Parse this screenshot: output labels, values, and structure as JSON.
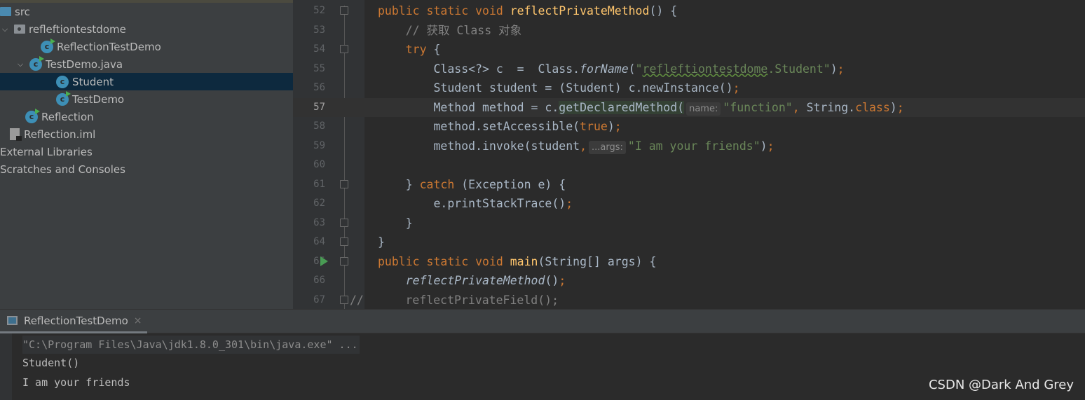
{
  "project_tree": [
    {
      "label": "src",
      "icon": "folder-icon",
      "indent": 0,
      "chevron": false
    },
    {
      "label": "refleftiontestdome",
      "icon": "package-icon",
      "indent": 0,
      "chevron": true
    },
    {
      "label": "ReflectionTestDemo",
      "icon": "class-run-icon",
      "indent": 2,
      "chevron": false
    },
    {
      "label": "TestDemo.java",
      "icon": "class-run-icon",
      "indent": 1,
      "chevron": true
    },
    {
      "label": "Student",
      "icon": "class-icon",
      "indent": 3,
      "chevron": false,
      "selected": true
    },
    {
      "label": "TestDemo",
      "icon": "class-run-icon",
      "indent": 3,
      "chevron": false
    },
    {
      "label": "Reflection",
      "icon": "class-run-icon",
      "indent": 1,
      "chevron": false
    },
    {
      "label": "Reflection.iml",
      "icon": "file-icon",
      "indent": 0,
      "chevron": false
    },
    {
      "label": "External Libraries",
      "icon": "none",
      "indent": -1,
      "chevron": false
    },
    {
      "label": "Scratches and Consoles",
      "icon": "none",
      "indent": -1,
      "chevron": false
    }
  ],
  "editor": {
    "current_line": "57",
    "lines": [
      {
        "n": "52",
        "fold": true,
        "seg": [
          {
            "t": "public static void ",
            "c": "kw"
          },
          {
            "t": "reflectPrivateMethod",
            "c": "fn"
          },
          {
            "t": "() {"
          }
        ]
      },
      {
        "n": "53",
        "seg": [
          {
            "t": "    // 获取 Class 对象",
            "c": "cm"
          }
        ]
      },
      {
        "n": "54",
        "fold": true,
        "seg": [
          {
            "t": "    "
          },
          {
            "t": "try",
            "c": "kw"
          },
          {
            "t": " {"
          }
        ]
      },
      {
        "n": "55",
        "seg": [
          {
            "t": "        Class<?> c  =  Class."
          },
          {
            "t": "forName",
            "c": "it"
          },
          {
            "t": "("
          },
          {
            "t": "\"",
            "c": "str"
          },
          {
            "t": "refleftiontestdome",
            "c": "str wavy"
          },
          {
            "t": ".Student\"",
            "c": "str"
          },
          {
            "t": ")"
          },
          {
            "t": ";",
            "c": "kw"
          }
        ]
      },
      {
        "n": "56",
        "seg": [
          {
            "t": "        Student student = (Student) c.newInstance()"
          },
          {
            "t": ";",
            "c": "kw"
          }
        ]
      },
      {
        "n": "57",
        "seg": [
          {
            "t": "        Method method = c."
          },
          {
            "t": "getDeclaredMethod(",
            "c": "hl"
          },
          {
            "t": "name:",
            "c": "hint"
          },
          {
            "t": "\"function\"",
            "c": "str"
          },
          {
            "t": ", ",
            "c": "kw"
          },
          {
            "t": "String."
          },
          {
            "t": "class",
            "c": "kw"
          },
          {
            "t": ")"
          },
          {
            "t": ";",
            "c": "kw"
          }
        ]
      },
      {
        "n": "58",
        "seg": [
          {
            "t": "        method.setAccessible("
          },
          {
            "t": "true",
            "c": "kw"
          },
          {
            "t": ")"
          },
          {
            "t": ";",
            "c": "kw"
          }
        ]
      },
      {
        "n": "59",
        "seg": [
          {
            "t": "        method.invoke(student"
          },
          {
            "t": ",",
            "c": "kw"
          },
          {
            "t": "...args:",
            "c": "hint"
          },
          {
            "t": "\"I am your friends\"",
            "c": "str"
          },
          {
            "t": ")"
          },
          {
            "t": ";",
            "c": "kw"
          }
        ]
      },
      {
        "n": "60",
        "seg": []
      },
      {
        "n": "61",
        "fold": true,
        "seg": [
          {
            "t": "    } "
          },
          {
            "t": "catch",
            "c": "kw"
          },
          {
            "t": " (Exception e) {"
          }
        ]
      },
      {
        "n": "62",
        "seg": [
          {
            "t": "        e.printStackTrace()"
          },
          {
            "t": ";",
            "c": "kw"
          }
        ]
      },
      {
        "n": "63",
        "fold": true,
        "seg": [
          {
            "t": "    }"
          }
        ]
      },
      {
        "n": "64",
        "fold": true,
        "seg": [
          {
            "t": "}"
          }
        ]
      },
      {
        "n": "65",
        "fold": true,
        "run": true,
        "seg": [
          {
            "t": "public static void ",
            "c": "kw"
          },
          {
            "t": "main",
            "c": "fn"
          },
          {
            "t": "(String[] args) {"
          }
        ]
      },
      {
        "n": "66",
        "seg": [
          {
            "t": "    "
          },
          {
            "t": "reflectPrivateMethod",
            "c": "it"
          },
          {
            "t": "()"
          },
          {
            "t": ";",
            "c": "kw"
          }
        ]
      },
      {
        "n": "67",
        "fold": true,
        "seg": [
          {
            "t": "//",
            "c": "cm"
          },
          {
            "t": "      reflectPrivateField();",
            "c": "cm"
          }
        ]
      }
    ]
  },
  "run_panel": {
    "tab_label": "ReflectionTestDemo",
    "close_glyph": "×",
    "output": [
      "\"C:\\Program Files\\Java\\jdk1.8.0_301\\bin\\java.exe\" ...",
      "Student()",
      "I am your friends"
    ]
  },
  "watermark": "CSDN @Dark And Grey"
}
